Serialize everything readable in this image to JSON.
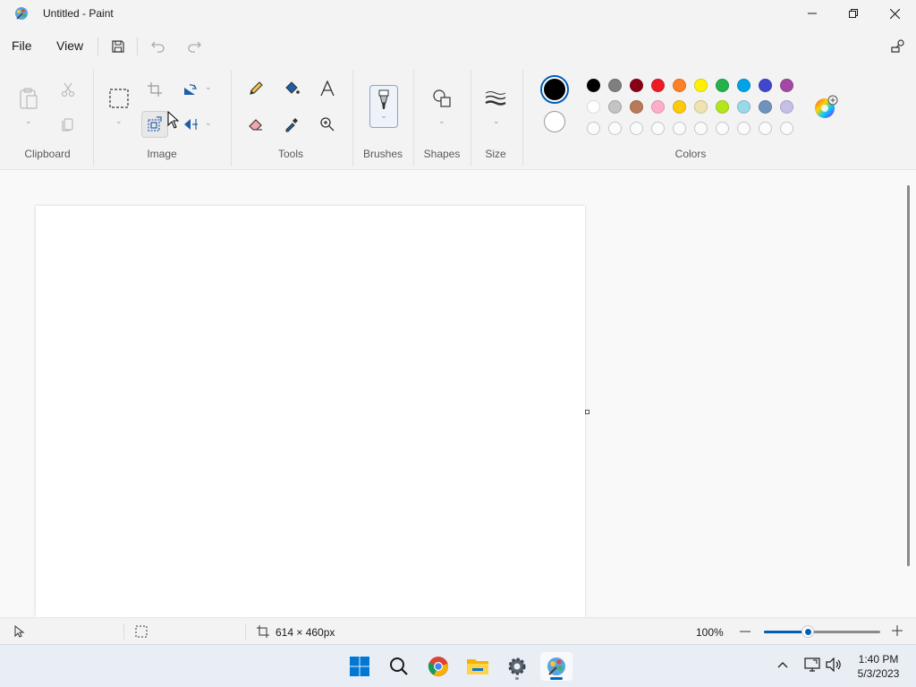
{
  "window": {
    "title": "Untitled - Paint"
  },
  "menu": {
    "file": "File",
    "view": "View"
  },
  "ribbon": {
    "groups": {
      "clipboard": "Clipboard",
      "image": "Image",
      "tools": "Tools",
      "brushes": "Brushes",
      "shapes": "Shapes",
      "size": "Size",
      "colors": "Colors"
    },
    "colors": {
      "primary": "#000000",
      "secondary": "#ffffff",
      "row1": [
        "#000000",
        "#7f7f7f",
        "#880015",
        "#ed1c24",
        "#ff7f27",
        "#fff200",
        "#22b14c",
        "#00a2e8",
        "#3f48cc",
        "#a349a4"
      ],
      "row2": [
        "#ffffff",
        "#c3c3c3",
        "#b97a57",
        "#ffaec9",
        "#ffc90e",
        "#efe4b0",
        "#b5e61d",
        "#99d9ea",
        "#7092be",
        "#c8bfe7"
      ]
    }
  },
  "statusbar": {
    "canvas_size": "614 × 460px",
    "zoom": "100%",
    "zoom_fraction": 0.38
  },
  "taskbar": {
    "time": "1:40 PM",
    "date": "5/3/2023"
  }
}
